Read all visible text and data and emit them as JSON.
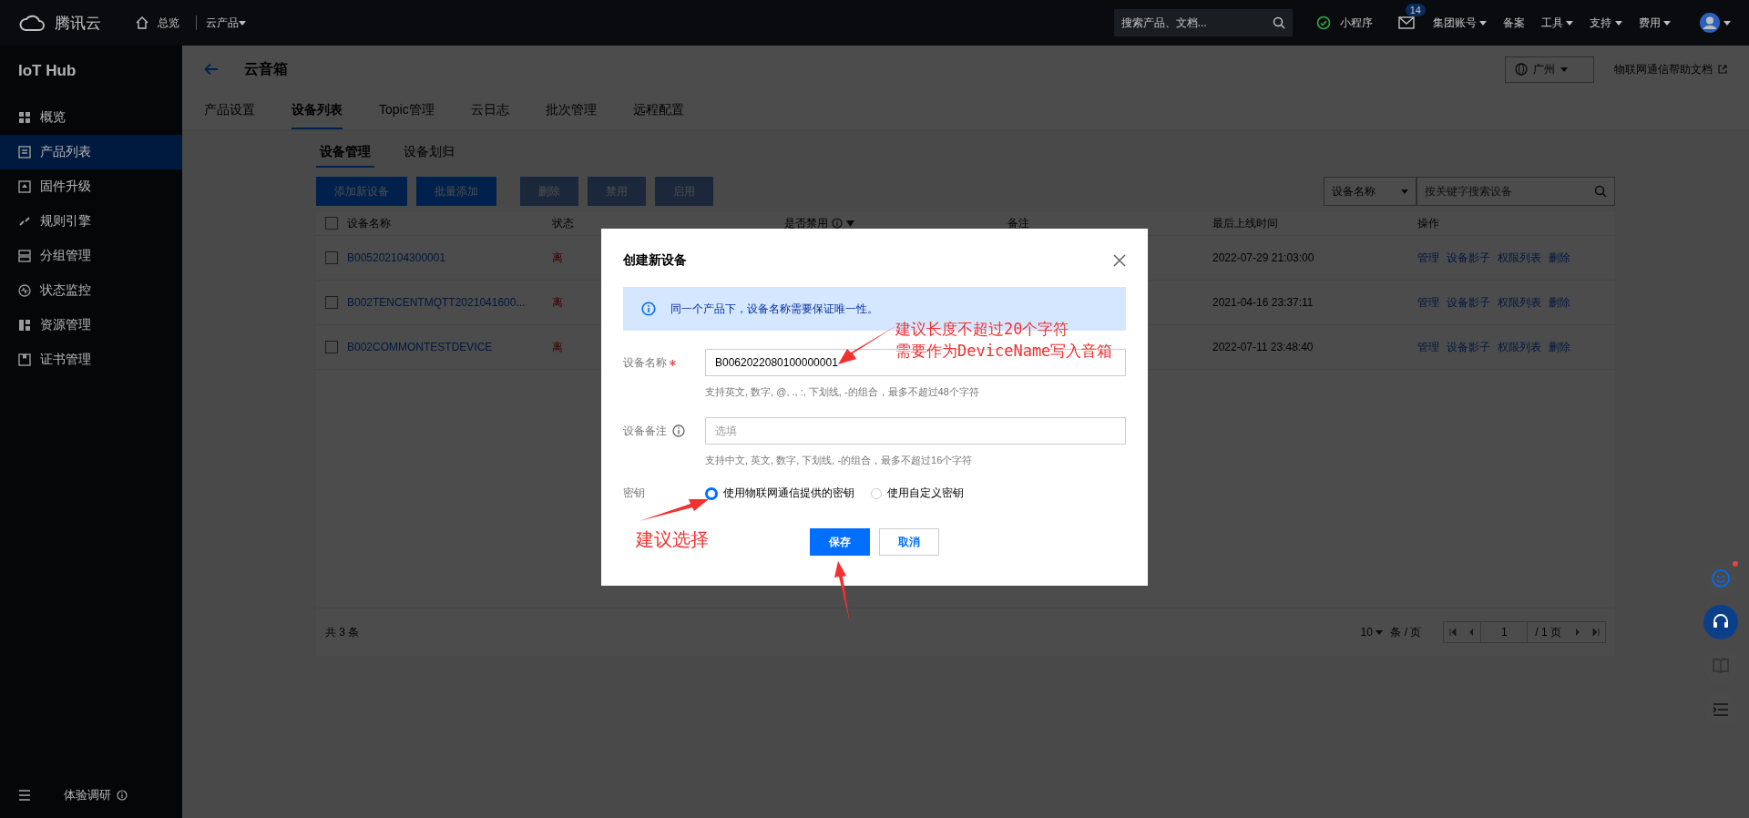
{
  "topbar": {
    "brand": "腾讯云",
    "home": "总览",
    "products": "云产品",
    "search": {
      "placeholder": "搜索产品、文档..."
    },
    "mini_program": "小程序",
    "mail_badge": "14",
    "menus": [
      {
        "label": "集团账号",
        "dropdown": true
      },
      {
        "label": "备案",
        "dropdown": false
      },
      {
        "label": "工具",
        "dropdown": true
      },
      {
        "label": "支持",
        "dropdown": true
      },
      {
        "label": "费用",
        "dropdown": true
      }
    ]
  },
  "sidebar": {
    "title": "IoT Hub",
    "items": [
      {
        "label": "概览",
        "selected": false
      },
      {
        "label": "产品列表",
        "selected": true
      },
      {
        "label": "固件升级",
        "selected": false
      },
      {
        "label": "规则引擎",
        "selected": false
      },
      {
        "label": "分组管理",
        "selected": false
      },
      {
        "label": "状态监控",
        "selected": false
      },
      {
        "label": "资源管理",
        "selected": false
      },
      {
        "label": "证书管理",
        "selected": false
      }
    ],
    "survey": "体验调研"
  },
  "header": {
    "title": "云音箱",
    "region": "广州",
    "help_link": "物联网通信帮助文档",
    "tabs": [
      {
        "label": "产品设置",
        "selected": false
      },
      {
        "label": "设备列表",
        "selected": true
      },
      {
        "label": "Topic管理",
        "selected": false
      },
      {
        "label": "云日志",
        "selected": false
      },
      {
        "label": "批次管理",
        "selected": false
      },
      {
        "label": "远程配置",
        "selected": false
      }
    ]
  },
  "subtabs": [
    {
      "label": "设备管理",
      "selected": true
    },
    {
      "label": "设备划归",
      "selected": false
    }
  ],
  "actions": [
    {
      "label": "添加新设备",
      "disabled": false
    },
    {
      "label": "批量添加",
      "disabled": false
    },
    {
      "label": "删除",
      "disabled": true
    },
    {
      "label": "禁用",
      "disabled": true
    },
    {
      "label": "启用",
      "disabled": true
    }
  ],
  "filter": {
    "field": "设备名称",
    "search": {
      "placeholder": "按关键字搜索设备"
    }
  },
  "table": {
    "all_checked": false,
    "columns": [
      "设备名称",
      "状态",
      "是否禁用",
      "备注",
      "最后上线时间",
      "操作"
    ],
    "rows": [
      {
        "checked": false,
        "name": "B005202104300001",
        "status": "离",
        "last_online": "2022-07-29 21:03:00",
        "ops": [
          "管理",
          "设备影子",
          "权限列表",
          "删除"
        ]
      },
      {
        "checked": false,
        "name": "B002TENCENTMQTT2021041600...",
        "status": "离",
        "last_online": "2021-04-16 23:37:11",
        "ops": [
          "管理",
          "设备影子",
          "权限列表",
          "删除"
        ]
      },
      {
        "checked": false,
        "name": "B002COMMONTESTDEVICE",
        "status": "离",
        "last_online": "2022-07-11 23:48:40",
        "ops": [
          "管理",
          "设备影子",
          "权限列表",
          "删除"
        ]
      }
    ]
  },
  "pagination": {
    "total": "共 3 条",
    "page_size": "10",
    "per_page": "条 / 页",
    "page": "1",
    "pages": "/ 1 页"
  },
  "modal": {
    "title": "创建新设备",
    "notice": "同一个产品下，设备名称需要保证唯一性。",
    "name_field": {
      "label": "设备名称",
      "required": true,
      "value": "B0062022080100000001",
      "hint": "支持英文, 数字, @, ., :, 下划线, -的组合，最多不超过48个字符"
    },
    "remark_field": {
      "label": "设备备注",
      "placeholder": "选填",
      "hint": "支持中文, 英文, 数字, 下划线, -的组合，最多不超过16个字符"
    },
    "key_label": "密钥",
    "key_options": [
      {
        "label": "使用物联网通信提供的密钥",
        "selected": true
      },
      {
        "label": "使用自定义密钥",
        "selected": false
      }
    ],
    "buttons": [
      {
        "label": "保存",
        "kind": "primary"
      },
      {
        "label": "取消",
        "kind": "default"
      }
    ]
  },
  "annotations": [
    {
      "lines": [
        "建议长度不超过20个字符",
        "需要作为DeviceName写入音箱"
      ]
    },
    {
      "lines": [
        "建议选择"
      ]
    }
  ]
}
